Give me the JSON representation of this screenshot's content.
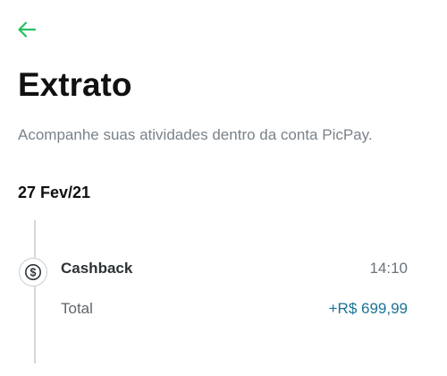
{
  "colors": {
    "accent": "#21c25e",
    "title": "#111111",
    "subtitle": "#7a8289",
    "amount_positive": "#1a7396",
    "timeline": "#d4d8dc"
  },
  "header": {
    "back_icon": "arrow-left-icon",
    "title": "Extrato",
    "subtitle": "Acompanhe suas atividades dentro da conta PicPay."
  },
  "statement": {
    "groups": [
      {
        "date": "27 Fev/21",
        "transactions": [
          {
            "icon": "dollar-circle-icon",
            "title": "Cashback",
            "time": "14:10",
            "total_label": "Total",
            "amount": "+R$ 699,99"
          }
        ]
      }
    ]
  }
}
